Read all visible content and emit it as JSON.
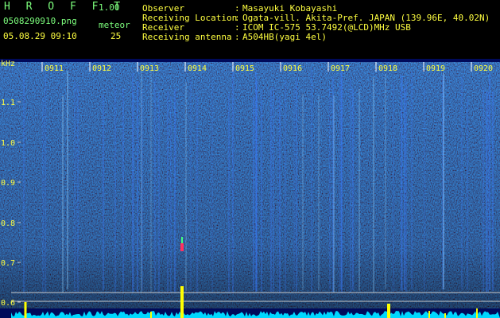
{
  "header": {
    "app_title": "H R O F F T",
    "version": "1.00",
    "filename": "0508290910.png",
    "datetime": "05.08.29 09:10",
    "meteor_label": "meteor",
    "meteor_count": "25",
    "info": [
      {
        "key": "Observer",
        "value": "Masayuki Kobayashi"
      },
      {
        "key": "Receiving Location",
        "value": "Ogata-vill. Akita-Pref. JAPAN (139.96E, 40.02N)"
      },
      {
        "key": "Receiver",
        "value": "ICOM IC-575 53.7492(@LCD)MHz USB"
      },
      {
        "key": "Receiving antenna",
        "value": "A504HB(yagi 4el)"
      }
    ]
  },
  "spectrogram": {
    "unit_label": "kHz",
    "y_ticks": [
      "1.1",
      "1.0",
      "0.9",
      "0.8",
      "0.7",
      "0.6"
    ],
    "time_labels": [
      "0911",
      "0912",
      "0913",
      "0914",
      "0915",
      "0916",
      "0917",
      "0918",
      "0919",
      "0920"
    ],
    "colors": {
      "background": "#000a5a",
      "label": "#ffff40",
      "trace": "#00d8ff",
      "peak": "#ffff00",
      "meteor": "#ff3060"
    }
  }
}
